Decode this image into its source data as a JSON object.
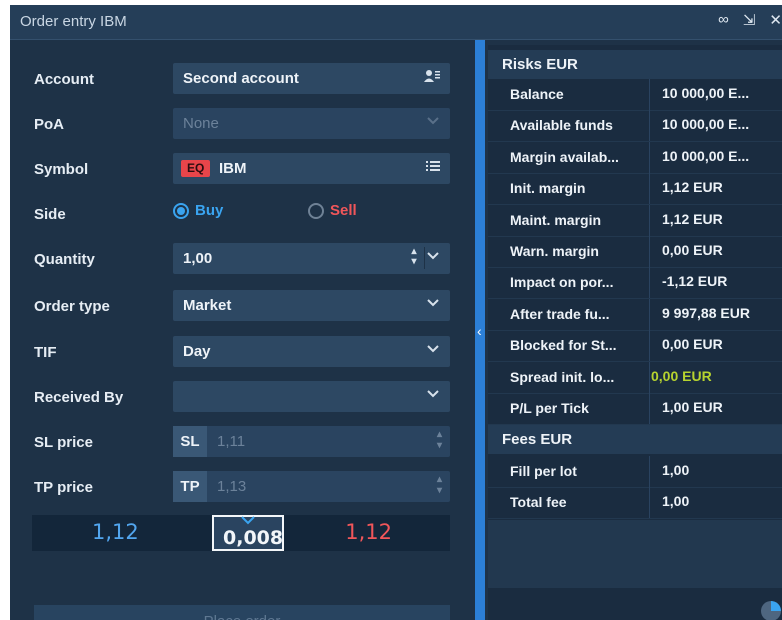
{
  "window": {
    "title": "Order entry IBM"
  },
  "titlebar": {
    "link_icon": "link-icon",
    "menu_icon": "menu-arrow-icon",
    "close_icon": "close-icon"
  },
  "form": {
    "account": {
      "label": "Account",
      "value": "Second account"
    },
    "poa": {
      "label": "PoA",
      "value": "None"
    },
    "symbol": {
      "label": "Symbol",
      "badge": "EQ",
      "value": "IBM"
    },
    "side": {
      "label": "Side",
      "buy": "Buy",
      "sell": "Sell",
      "selected": "Buy"
    },
    "quantity": {
      "label": "Quantity",
      "value": "1,00"
    },
    "order_type": {
      "label": "Order type",
      "value": "Market"
    },
    "tif": {
      "label": "TIF",
      "value": "Day"
    },
    "received_by": {
      "label": "Received By",
      "value": ""
    },
    "sl_price": {
      "label": "SL price",
      "tag": "SL",
      "value": "1,11"
    },
    "tp_price": {
      "label": "TP price",
      "tag": "TP",
      "value": "1,13"
    }
  },
  "prices": {
    "bid": "1,12",
    "spread": "0,008",
    "ask": "1,12"
  },
  "place_order_label": "Place order",
  "risks": {
    "header": "Risks EUR",
    "rows": [
      {
        "k": "Balance",
        "v": "10 000,00 E..."
      },
      {
        "k": "Available  funds",
        "v": "10 000,00 E..."
      },
      {
        "k": "Margin  availab...",
        "v": "10 000,00 E..."
      },
      {
        "k": "Init. margin",
        "v": "1,12 EUR"
      },
      {
        "k": "Maint. margin",
        "v": "1,12 EUR"
      },
      {
        "k": "Warn. margin",
        "v": "0,00 EUR"
      },
      {
        "k": "Impact on por...",
        "v": "-1,12 EUR"
      },
      {
        "k": "After trade fu...",
        "v": "9 997,88 EUR"
      },
      {
        "k": "Blocked for St...",
        "v": "0,00 EUR"
      },
      {
        "k": "Spread init. lo...",
        "v": "0,00 EUR"
      },
      {
        "k": "P/L per Tick",
        "v": "1,00 EUR"
      }
    ]
  },
  "fees": {
    "header": "Fees EUR",
    "rows": [
      {
        "k": "Fill per lot",
        "v": "1,00"
      },
      {
        "k": "Total fee",
        "v": "1,00"
      }
    ]
  },
  "colors": {
    "accent": "#2c7fd6",
    "bid": "#52a6ef",
    "ask": "#f0565a",
    "highlight": "#b7d32f",
    "badge": "#e8454a"
  }
}
